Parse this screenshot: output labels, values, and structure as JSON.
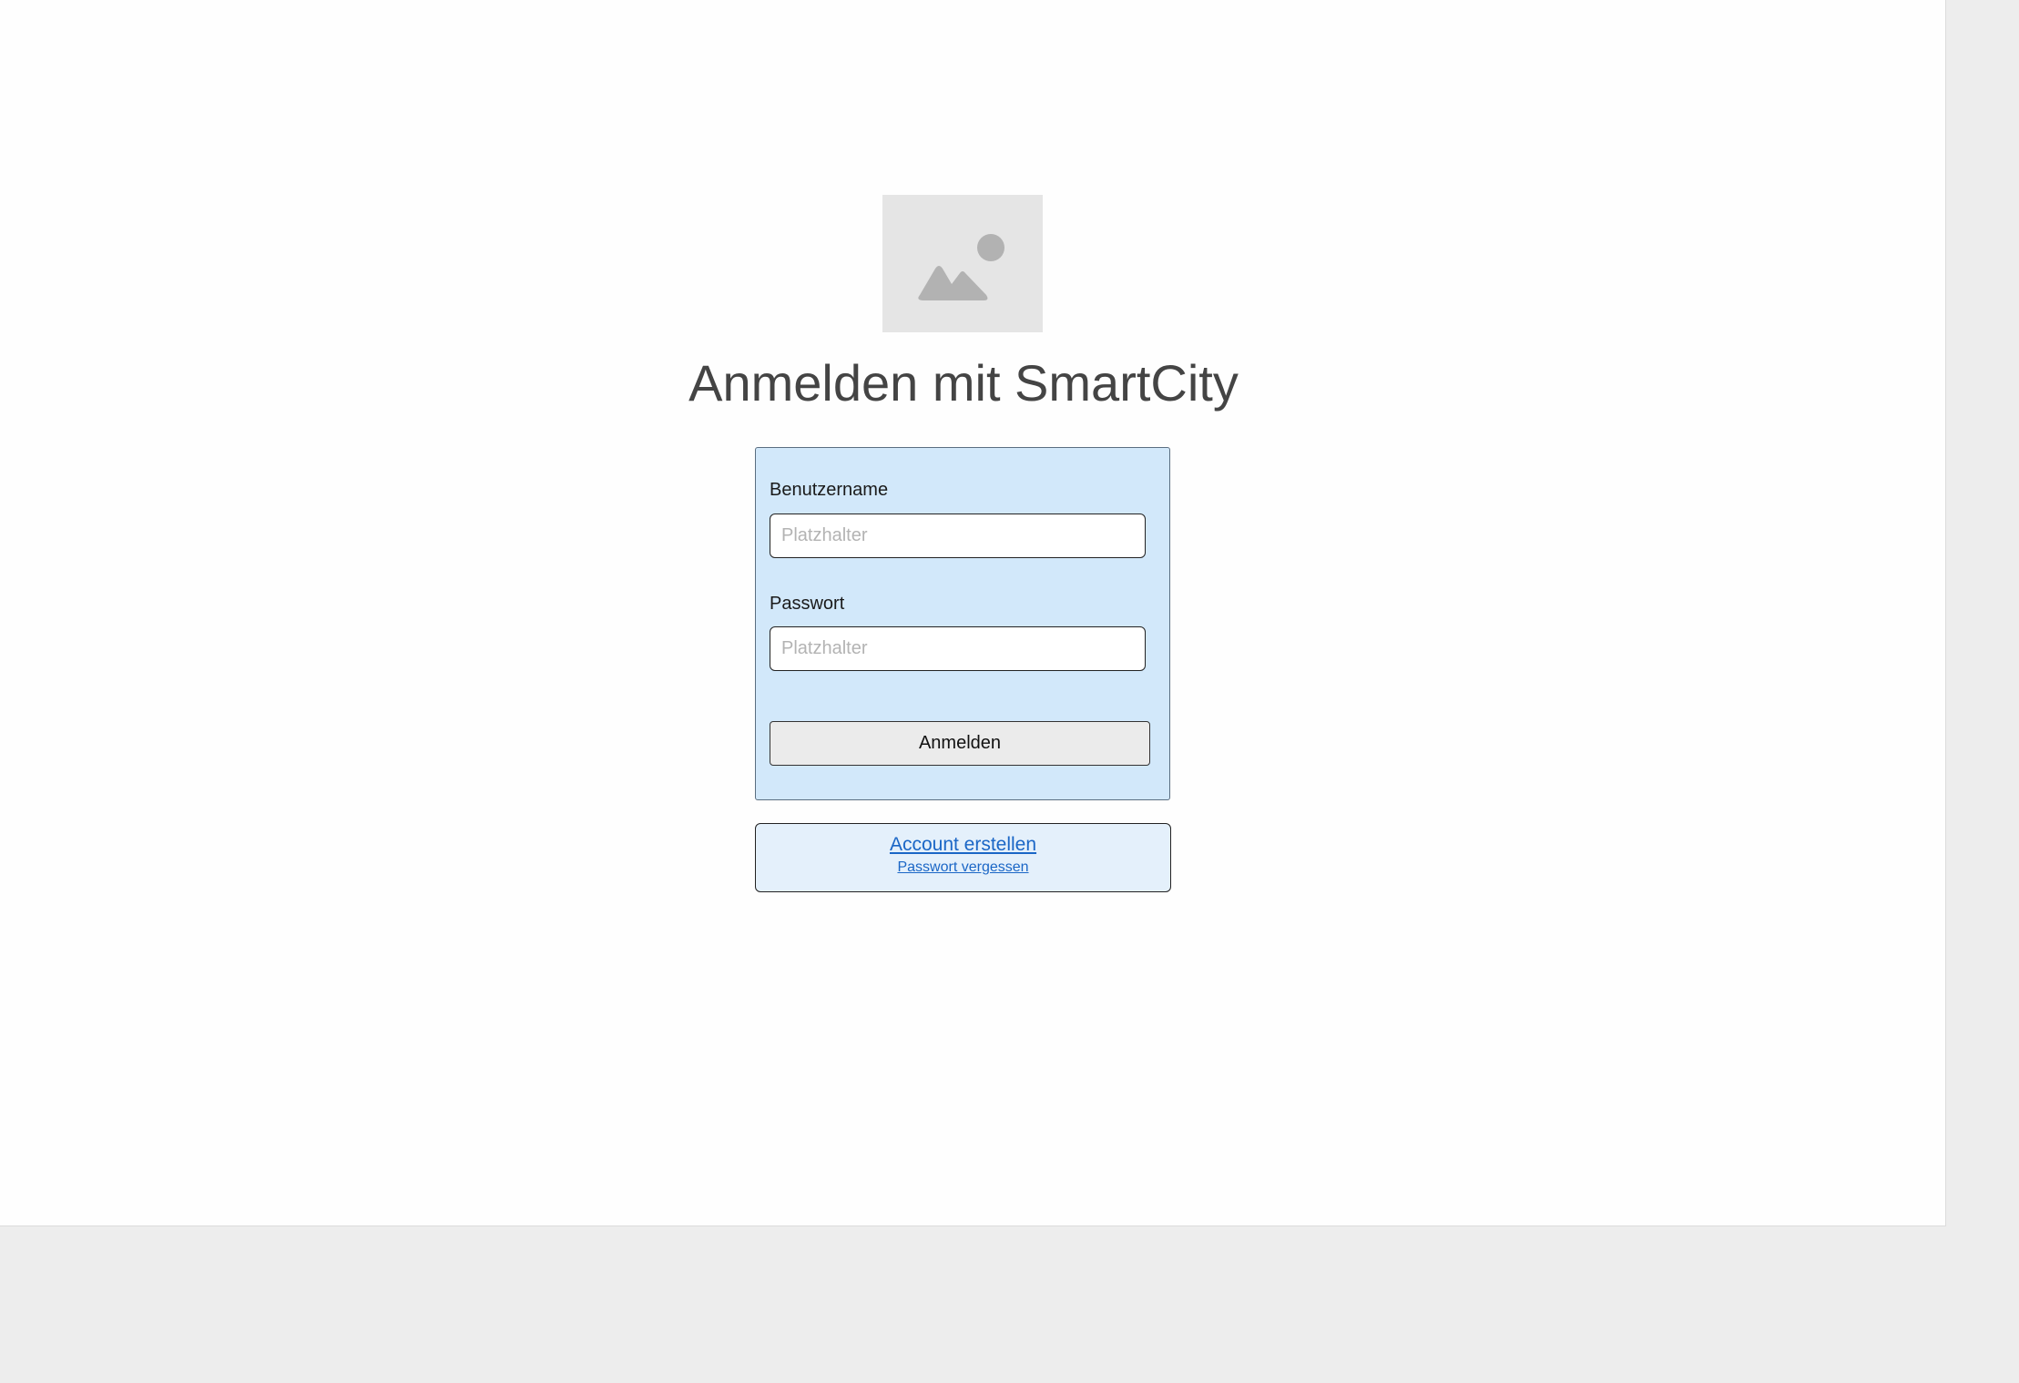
{
  "page": {
    "title": "Anmelden mit SmartCity",
    "logo_icon": "image-placeholder-icon"
  },
  "login_form": {
    "username": {
      "label": "Benutzername",
      "placeholder": "Platzhalter",
      "value": ""
    },
    "password": {
      "label": "Passwort",
      "placeholder": "Platzhalter",
      "value": ""
    },
    "submit_label": "Anmelden"
  },
  "links": {
    "create_account": "Account erstellen",
    "forgot_password": "Passwort vergessen"
  },
  "colors": {
    "form_background": "#d2e8fa",
    "links_background": "#e4f0fb",
    "link": "#1a66c6",
    "page_background": "#fefefe",
    "outer_background": "#ededed"
  }
}
